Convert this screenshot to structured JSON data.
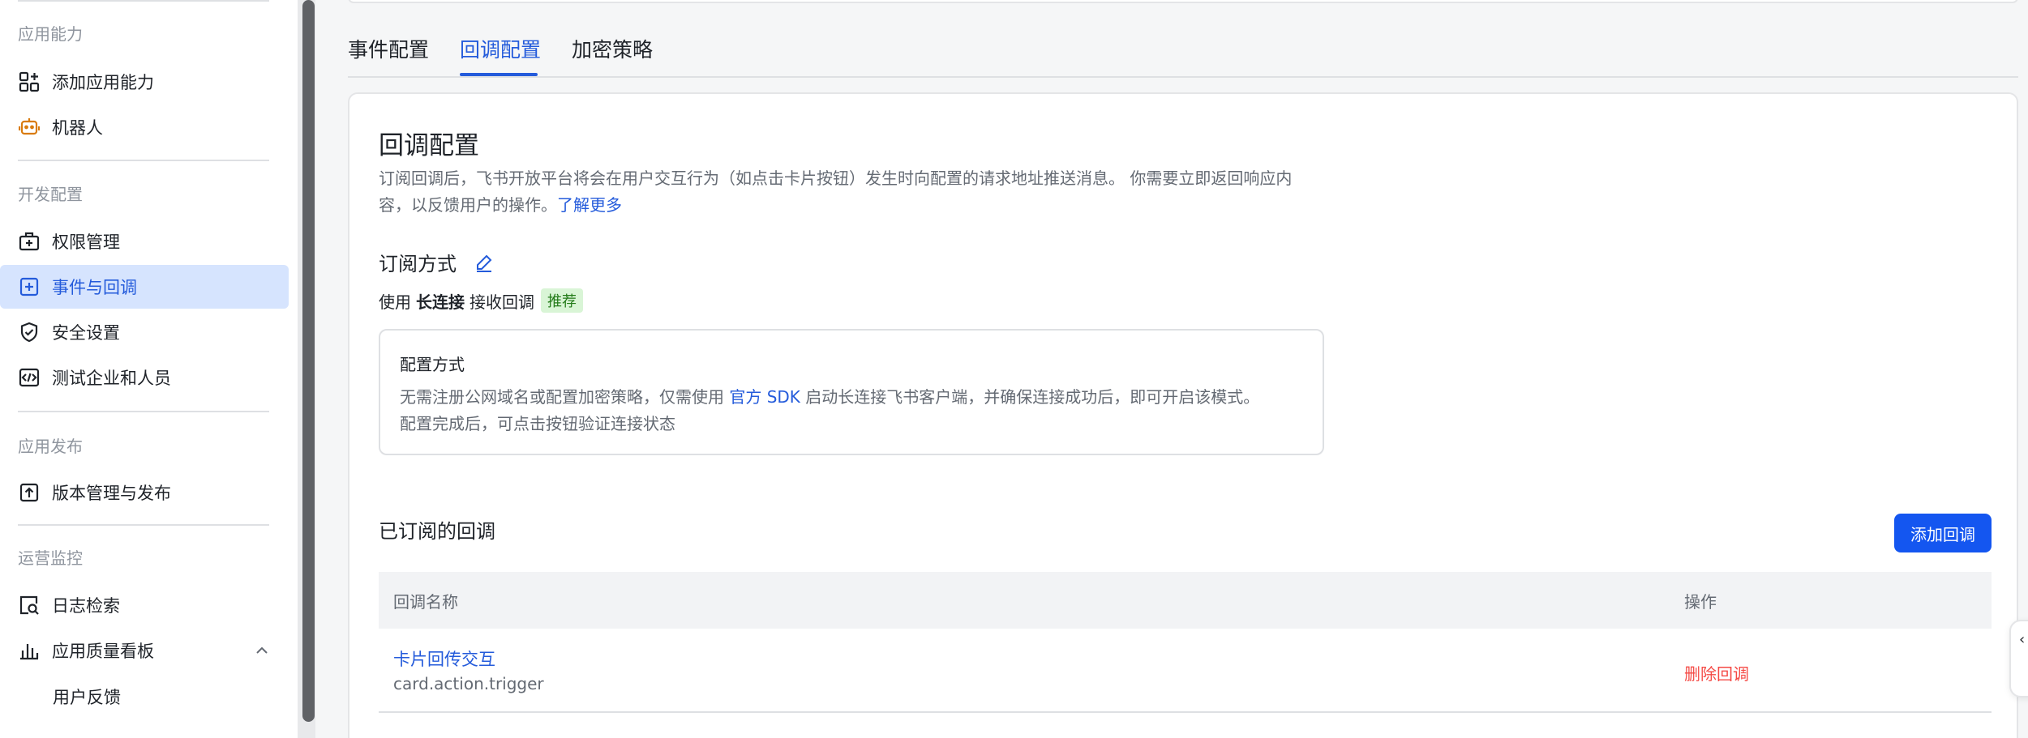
{
  "sidebar": {
    "sections": {
      "app_capability": "应用能力",
      "dev_config": "开发配置",
      "app_release": "应用发布",
      "ops_monitor": "运营监控"
    },
    "items": {
      "add_capability": "添加应用能力",
      "robot": "机器人",
      "permissions": "权限管理",
      "events_callbacks": "事件与回调",
      "security": "安全设置",
      "test_enterprise": "测试企业和人员",
      "version_release": "版本管理与发布",
      "log_search": "日志检索",
      "quality_board": "应用质量看板",
      "user_feedback": "用户反馈"
    }
  },
  "tabs": {
    "event_config": "事件配置",
    "callback_config": "回调配置",
    "encrypt_strategy": "加密策略"
  },
  "panel": {
    "title": "回调配置",
    "desc_line1": "订阅回调后，飞书开放平台将会在用户交互行为（如点击卡片按钮）发生时向配置的请求地址推送消息。 你需要立即返回响应内",
    "desc_line2": "容，以反馈用户的操作。",
    "learn_more": "了解更多",
    "sub_mode_title": "订阅方式",
    "use_prefix": "使用",
    "use_bold": "长连接",
    "use_suffix": "接收回调",
    "badge": "推荐",
    "cfg_title": "配置方式",
    "cfg_text_a": "无需注册公网域名或配置加密策略，仅需使用",
    "cfg_sdk_link": "官方 SDK",
    "cfg_text_b": "启动长连接飞书客户端，并确保连接成功后，即可开启该模式。",
    "cfg_text_c": "配置完成后，可点击按钮验证连接状态",
    "subscribed_title": "已订阅的回调",
    "add_button": "添加回调"
  },
  "table": {
    "col_name": "回调名称",
    "col_action": "操作",
    "rows": [
      {
        "name": "卡片回传交互",
        "code": "card.action.trigger",
        "action": "删除回调"
      }
    ]
  },
  "colors": {
    "accent": "#245bdb",
    "primary_button": "#1456f0",
    "danger": "#f54a45",
    "active_bg": "#d6e4fe",
    "badge_bg": "#d9f5d6",
    "badge_text": "#237b19"
  }
}
